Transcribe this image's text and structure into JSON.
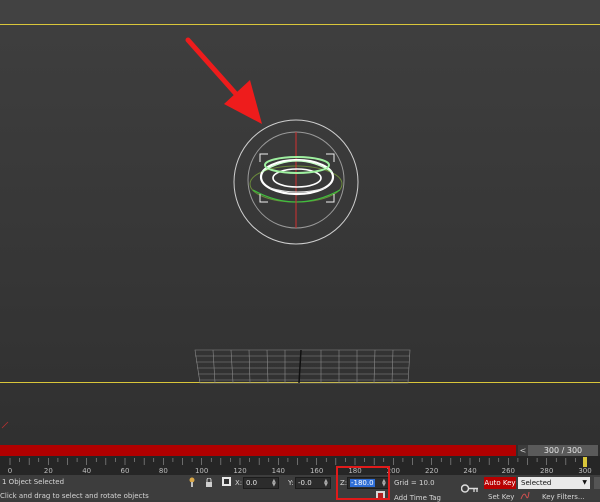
{
  "colors": {
    "accent": "#d9c63a",
    "timeline_red": "#b10000",
    "autokey_red": "#b80000",
    "annotation_red": "#e01a1a",
    "gizmo_green": "#5ecf5e"
  },
  "timeslider": {
    "prev_icon": "<",
    "frame": "300 / 300"
  },
  "timeline": {
    "ticks": [
      "0",
      "20",
      "40",
      "60",
      "80",
      "100",
      "120",
      "140",
      "160",
      "180",
      "200",
      "220",
      "240",
      "260",
      "280",
      "300"
    ]
  },
  "status": {
    "selection": "1 Object Selected",
    "prompt": "Click and drag to select and rotate objects",
    "x_label": "X:",
    "x_value": "0.0",
    "y_label": "Y:",
    "y_value": "-0.0",
    "z_label": "Z:",
    "z_value": "-180.0",
    "grid": "Grid = 10.0",
    "add_time_tag": "Add Time Tag",
    "auto_key": "Auto Key",
    "selected": "Selected",
    "set_key": "Set Key",
    "key_filters": "Key Filters..."
  }
}
